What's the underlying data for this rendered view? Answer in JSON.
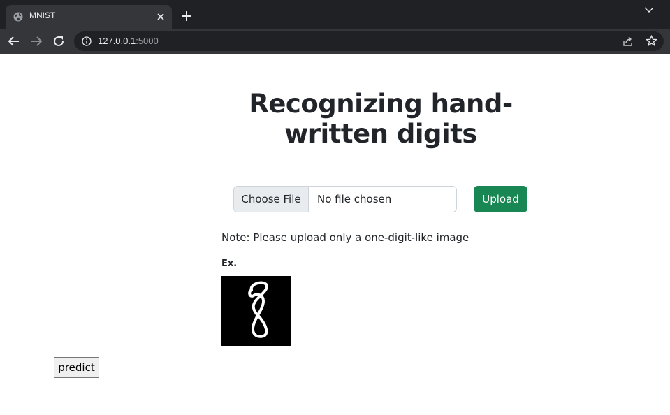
{
  "browser": {
    "tab": {
      "title": "MNIST",
      "favicon": "globe-icon"
    },
    "address": {
      "host": "127.0.0.1",
      "port": ":5000"
    },
    "icons": [
      "back-arrow-icon",
      "forward-arrow-icon",
      "reload-icon",
      "info-icon",
      "share-icon",
      "star-icon",
      "close-icon",
      "plus-icon",
      "chevron-down-icon"
    ]
  },
  "page": {
    "heading": "Recognizing hand-written digits",
    "file_input": {
      "button_label": "Choose File",
      "status": "No file chosen"
    },
    "upload_label": "Upload",
    "note": "Note: Please upload only a one-digit-like image",
    "example_label": "Ex.",
    "example_image": {
      "depicts": "8"
    },
    "predict_label": "predict"
  },
  "colors": {
    "chrome_dark": "#202124",
    "chrome_tab": "#35363a",
    "upload_green": "#198754",
    "text": "#212529"
  }
}
